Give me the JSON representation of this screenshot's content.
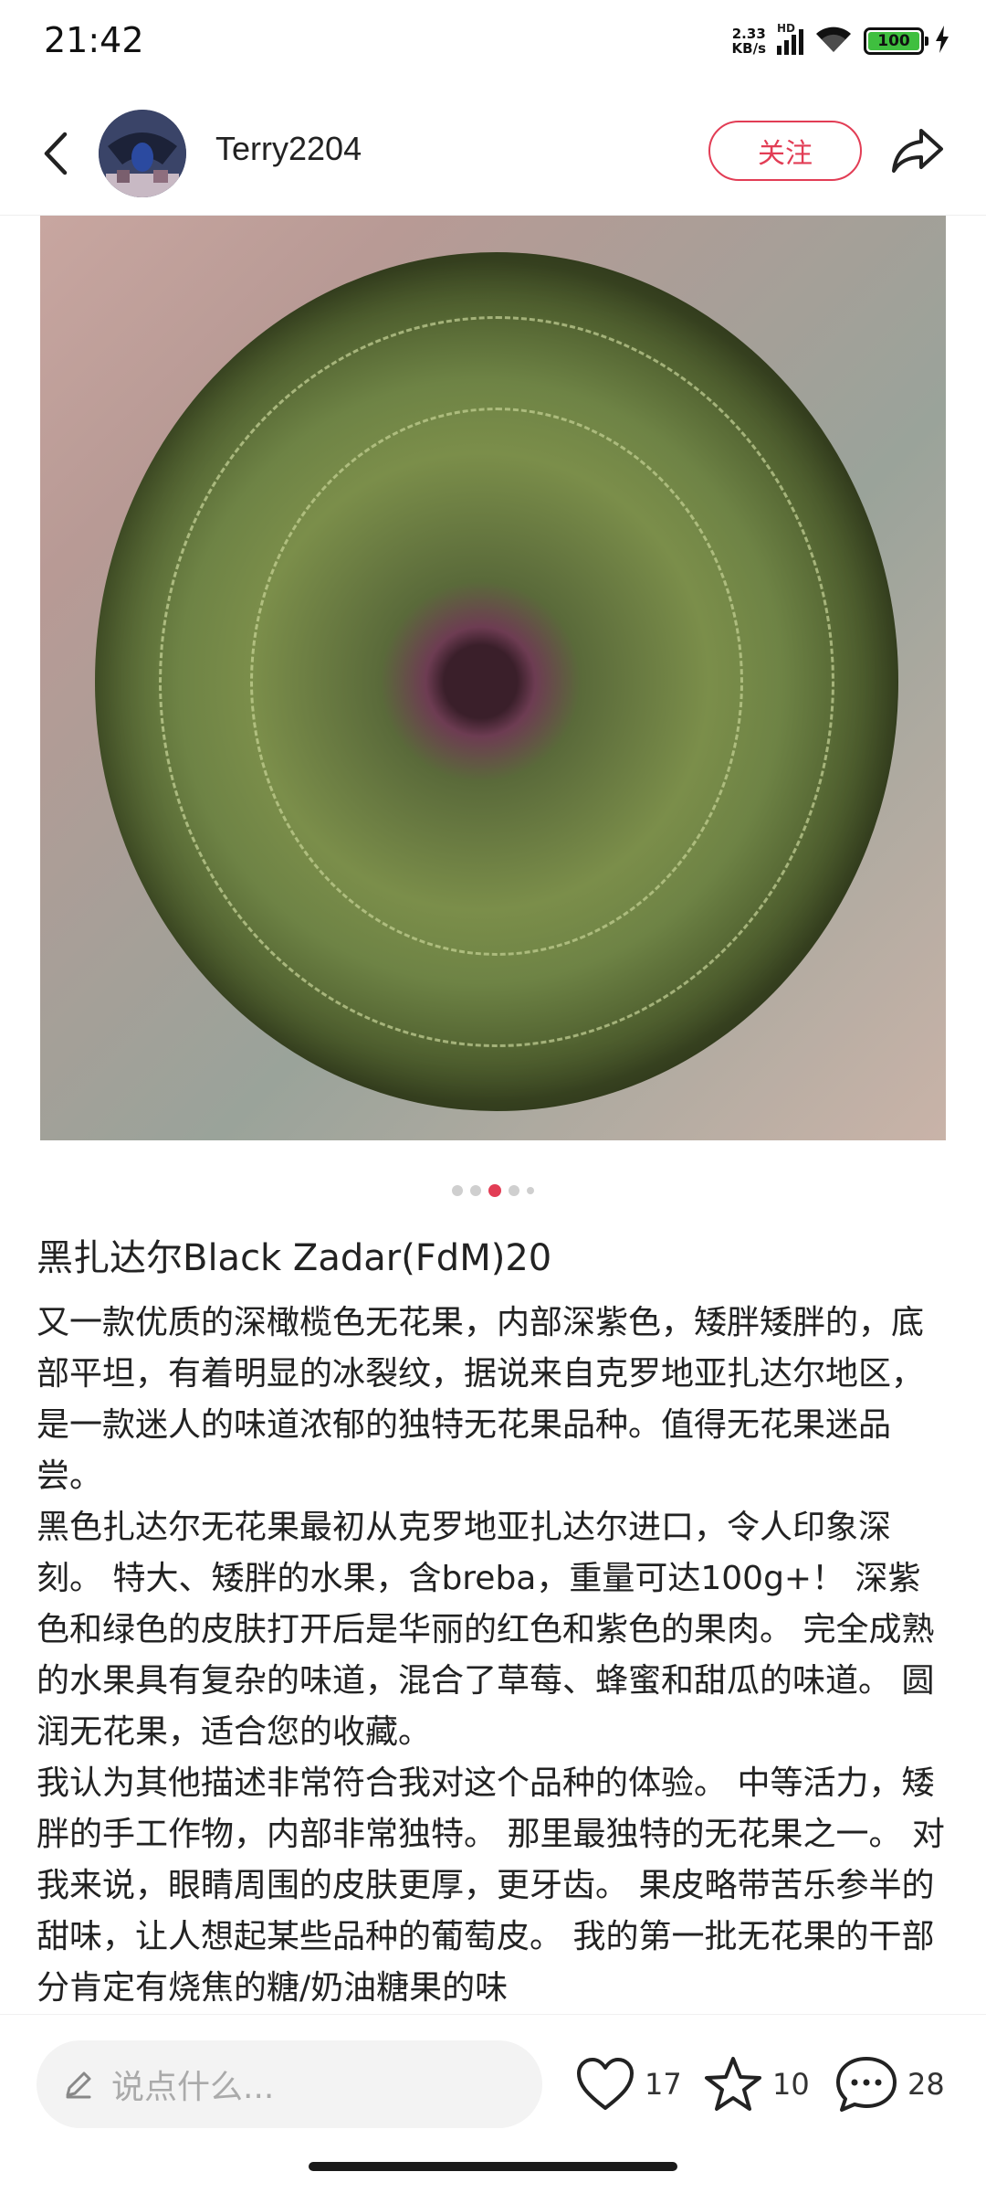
{
  "status_bar": {
    "time": "21:42",
    "net_speed_value": "2.33",
    "net_speed_unit": "KB/s",
    "network_type": "HD",
    "battery_level": "100"
  },
  "header": {
    "username": "Terry2204",
    "follow_label": "关注"
  },
  "carousel": {
    "total": 5,
    "active_index": 2
  },
  "post": {
    "title": "黑扎达尔Black Zadar(FdM)20",
    "paragraphs": [
      "又一款优质的深橄榄色无花果，内部深紫色，矮胖矮胖的，底部平坦，有着明显的冰裂纹，据说来自克罗地亚扎达尔地区，是一款迷人的味道浓郁的独特无花果品种。值得无花果迷品尝。",
      "黑色扎达尔无花果最初从克罗地亚扎达尔进口，令人印象深刻。 特大、矮胖的水果，含breba，重量可达100g+！ 深紫色和绿色的皮肤打开后是华丽的红色和紫色的果肉。 完全成熟的水果具有复杂的味道，混合了草莓、蜂蜜和甜瓜的味道。 圆润无花果，适合您的收藏。",
      "我认为其他描述非常符合我对这个品种的体验。 中等活力，矮胖的手工作物，内部非常独特。 那里最独特的无花果之一。 对我来说，眼睛周围的皮肤更厚，更牙齿。 果皮略带苦乐参半的甜味，让人想起某些品种的葡萄皮。 我的第一批无花果的干部分肯定有烧焦的糖/奶油糖果的味"
    ]
  },
  "bottom_bar": {
    "comment_placeholder": "说点什么...",
    "like_count": "17",
    "favorite_count": "10",
    "comment_count": "28"
  },
  "colors": {
    "accent": "#e23d55",
    "battery_green": "#3fbf3f"
  }
}
